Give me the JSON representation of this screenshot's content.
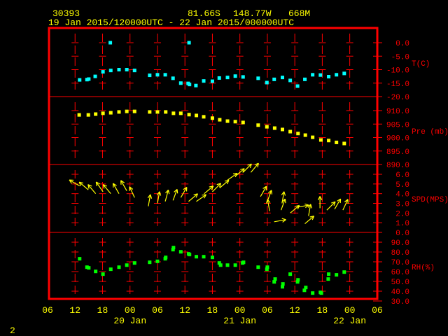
{
  "header": {
    "station": "30393",
    "latitude": "81.66S",
    "longitude": "148.77W",
    "elevation": "668M",
    "time_range": "19 Jan 2015/120000UTC - 22 Jan 2015/000000UTC",
    "page_number": "2"
  },
  "colors": {
    "frame": "#ff0000",
    "text": "#ffff00",
    "temp": "#00ffff",
    "pressure": "#ffff00",
    "wind": "#ffff00",
    "rh": "#00ff00"
  },
  "chart_data": {
    "type": "scatter",
    "title": "30393 81.66S 148.77W 668M",
    "subtitle": "19 Jan 2015/120000UTC - 22 Jan 2015/000000UTC",
    "x_unit": "hours since 19 Jan 2015 06UTC",
    "x_range": [
      0,
      72
    ],
    "x_ticks": [
      {
        "h": 0,
        "label": "06"
      },
      {
        "h": 6,
        "label": "12"
      },
      {
        "h": 12,
        "label": "18"
      },
      {
        "h": 18,
        "label": "00"
      },
      {
        "h": 24,
        "label": "06"
      },
      {
        "h": 30,
        "label": "12"
      },
      {
        "h": 36,
        "label": "18"
      },
      {
        "h": 42,
        "label": "00"
      },
      {
        "h": 48,
        "label": "06"
      },
      {
        "h": 54,
        "label": "12"
      },
      {
        "h": 60,
        "label": "18"
      },
      {
        "h": 66,
        "label": "00"
      },
      {
        "h": 72,
        "label": "06"
      }
    ],
    "date_labels": [
      {
        "h": 18,
        "label": "20 Jan"
      },
      {
        "h": 42,
        "label": "21 Jan"
      },
      {
        "h": 66,
        "label": "22 Jan"
      }
    ],
    "panels": [
      {
        "name": "temperature",
        "label": "T(C)",
        "ylim": [
          -20,
          2.5
        ],
        "ticks": [
          {
            "v": 0,
            "label": "0.0"
          },
          {
            "v": -5,
            "label": "-5.0"
          },
          {
            "v": -10,
            "label": "-10.0"
          },
          {
            "v": -15,
            "label": "-15.0"
          },
          {
            "v": -20,
            "label": "-20.0"
          }
        ],
        "points": [
          [
            7.0,
            -13.8
          ],
          [
            8.6,
            -13.7
          ],
          [
            9.0,
            -13.5
          ],
          [
            10.4,
            -12.5
          ],
          [
            12.1,
            -10.8
          ],
          [
            13.8,
            -10.3
          ],
          [
            15.6,
            -10.0
          ],
          [
            17.3,
            -10.0
          ],
          [
            19.0,
            -10.3
          ],
          [
            22.3,
            -12.1
          ],
          [
            24.0,
            -11.9
          ],
          [
            25.7,
            -11.9
          ],
          [
            27.4,
            -13.2
          ],
          [
            29.1,
            -15.0
          ],
          [
            30.7,
            -15.1
          ],
          [
            31.0,
            -15.5
          ],
          [
            32.4,
            -15.9
          ],
          [
            34.1,
            -14.2
          ],
          [
            36.0,
            -14.3
          ],
          [
            37.5,
            -13.1
          ],
          [
            39.3,
            -12.9
          ],
          [
            41.0,
            -12.4
          ],
          [
            42.7,
            -12.7
          ],
          [
            46.0,
            -13.2
          ],
          [
            47.9,
            -14.8
          ],
          [
            49.5,
            -13.6
          ],
          [
            51.3,
            -12.9
          ],
          [
            53.0,
            -14.0
          ],
          [
            54.6,
            -16.1
          ],
          [
            56.2,
            -13.6
          ],
          [
            57.9,
            -11.9
          ],
          [
            59.6,
            -12.0
          ],
          [
            61.4,
            -12.6
          ],
          [
            63.1,
            -11.9
          ],
          [
            64.8,
            -11.4
          ],
          [
            13.7,
            0.0
          ],
          [
            30.9,
            0.0
          ]
        ]
      },
      {
        "name": "pressure",
        "label": "Pre (mb)",
        "ylim": [
          890,
          915
        ],
        "ticks": [
          {
            "v": 910,
            "label": "910.0"
          },
          {
            "v": 905,
            "label": "905.0"
          },
          {
            "v": 900,
            "label": "900.0"
          },
          {
            "v": 895,
            "label": "895.0"
          },
          {
            "v": 890,
            "label": "890.0"
          }
        ],
        "points": [
          [
            6.9,
            908.4
          ],
          [
            8.9,
            908.4
          ],
          [
            10.5,
            908.7
          ],
          [
            12.1,
            909.0
          ],
          [
            13.8,
            909.2
          ],
          [
            15.6,
            909.5
          ],
          [
            17.3,
            909.7
          ],
          [
            19.0,
            909.7
          ],
          [
            22.3,
            909.5
          ],
          [
            24.0,
            909.5
          ],
          [
            25.8,
            909.5
          ],
          [
            27.5,
            909.0
          ],
          [
            29.1,
            909.0
          ],
          [
            30.9,
            908.5
          ],
          [
            32.5,
            908.2
          ],
          [
            34.1,
            907.7
          ],
          [
            36.0,
            907.2
          ],
          [
            37.6,
            906.6
          ],
          [
            39.3,
            906.1
          ],
          [
            41.0,
            905.9
          ],
          [
            42.7,
            905.6
          ],
          [
            46.0,
            904.6
          ],
          [
            47.9,
            904.0
          ],
          [
            49.6,
            903.5
          ],
          [
            51.3,
            903.0
          ],
          [
            53.0,
            902.2
          ],
          [
            54.7,
            901.5
          ],
          [
            56.3,
            900.9
          ],
          [
            57.9,
            900.1
          ],
          [
            59.7,
            899.1
          ],
          [
            61.4,
            898.9
          ],
          [
            63.1,
            898.2
          ],
          [
            64.8,
            897.8
          ]
        ]
      },
      {
        "name": "wind_speed",
        "label": "SPD(MPS)",
        "ylim": [
          0,
          7
        ],
        "ticks": [
          {
            "v": 6,
            "label": "6.0"
          },
          {
            "v": 5,
            "label": "5.0"
          },
          {
            "v": 4,
            "label": "4.0"
          },
          {
            "v": 3,
            "label": "3.0"
          },
          {
            "v": 2,
            "label": "2.0"
          },
          {
            "v": 1,
            "label": "1.0"
          },
          {
            "v": 0,
            "label": "0.0"
          }
        ],
        "point_note": "[hour, speed m/s, arrow direction deg clockwise from up]",
        "points": [
          [
            7.0,
            4.8,
            300
          ],
          [
            8.9,
            4.4,
            310
          ],
          [
            10.5,
            4.0,
            320
          ],
          [
            12.1,
            4.2,
            325
          ],
          [
            13.8,
            4.0,
            320
          ],
          [
            15.6,
            4.0,
            330
          ],
          [
            17.3,
            4.3,
            330
          ],
          [
            19.0,
            3.6,
            335
          ],
          [
            22.0,
            2.7,
            10
          ],
          [
            24.0,
            3.0,
            10
          ],
          [
            25.7,
            3.2,
            15
          ],
          [
            27.4,
            3.3,
            20
          ],
          [
            29.1,
            3.6,
            30
          ],
          [
            30.8,
            3.2,
            50
          ],
          [
            32.5,
            3.2,
            55
          ],
          [
            34.2,
            4.0,
            50
          ],
          [
            36.0,
            4.2,
            45
          ],
          [
            37.6,
            4.6,
            50
          ],
          [
            39.3,
            5.4,
            55
          ],
          [
            41.0,
            5.8,
            50
          ],
          [
            42.7,
            6.2,
            45
          ],
          [
            44.4,
            6.2,
            40
          ],
          [
            46.5,
            3.7,
            30
          ],
          [
            48.0,
            3.2,
            20
          ],
          [
            48.5,
            2.2,
            350
          ],
          [
            49.5,
            1.1,
            80
          ],
          [
            51.0,
            2.3,
            20
          ],
          [
            51.2,
            3.0,
            10
          ],
          [
            53.0,
            2.0,
            50
          ],
          [
            54.5,
            2.6,
            80
          ],
          [
            56.2,
            0.9,
            50
          ],
          [
            57.0,
            1.7,
            10
          ],
          [
            59.5,
            2.5,
            0
          ],
          [
            61.0,
            2.3,
            45
          ],
          [
            62.7,
            2.4,
            30
          ],
          [
            64.5,
            2.3,
            25
          ]
        ]
      },
      {
        "name": "relative_humidity",
        "label": "RH(%)",
        "ylim": [
          30,
          100
        ],
        "ticks": [
          {
            "v": 90,
            "label": "90.0"
          },
          {
            "v": 80,
            "label": "80.0"
          },
          {
            "v": 70,
            "label": "70.0"
          },
          {
            "v": 60,
            "label": "60.0"
          },
          {
            "v": 50,
            "label": "50.0"
          },
          {
            "v": 40,
            "label": "40.0"
          },
          {
            "v": 30,
            "label": "30.0"
          }
        ],
        "points": [
          [
            7.0,
            73.1
          ],
          [
            8.6,
            64.5
          ],
          [
            9.0,
            63.8
          ],
          [
            10.5,
            60.2
          ],
          [
            12.1,
            57.4
          ],
          [
            13.8,
            62.4
          ],
          [
            15.6,
            64.5
          ],
          [
            17.3,
            66.6
          ],
          [
            19.0,
            68.8
          ],
          [
            22.3,
            69.5
          ],
          [
            24.0,
            70.5
          ],
          [
            25.7,
            73.1
          ],
          [
            25.8,
            74.5
          ],
          [
            27.4,
            82.4
          ],
          [
            27.5,
            84.5
          ],
          [
            29.1,
            80.2
          ],
          [
            30.8,
            78.1
          ],
          [
            31.0,
            77.4
          ],
          [
            32.5,
            75.2
          ],
          [
            34.1,
            75.2
          ],
          [
            36.0,
            74.5
          ],
          [
            37.5,
            68.8
          ],
          [
            37.8,
            66.6
          ],
          [
            39.3,
            66.6
          ],
          [
            41.0,
            66.6
          ],
          [
            42.6,
            68.8
          ],
          [
            42.8,
            69.5
          ],
          [
            46.0,
            64.5
          ],
          [
            47.9,
            62.4
          ],
          [
            48.0,
            64.5
          ],
          [
            49.5,
            49.5
          ],
          [
            49.7,
            52.4
          ],
          [
            51.3,
            44.5
          ],
          [
            51.4,
            47.4
          ],
          [
            53.0,
            57.4
          ],
          [
            54.6,
            49.5
          ],
          [
            54.7,
            51.6
          ],
          [
            56.1,
            40.9
          ],
          [
            56.4,
            43.8
          ],
          [
            57.9,
            38.1
          ],
          [
            59.6,
            38.8
          ],
          [
            59.8,
            38.1
          ],
          [
            61.3,
            52.4
          ],
          [
            61.4,
            57.4
          ],
          [
            63.1,
            56.7
          ],
          [
            64.8,
            59.5
          ]
        ]
      }
    ]
  }
}
